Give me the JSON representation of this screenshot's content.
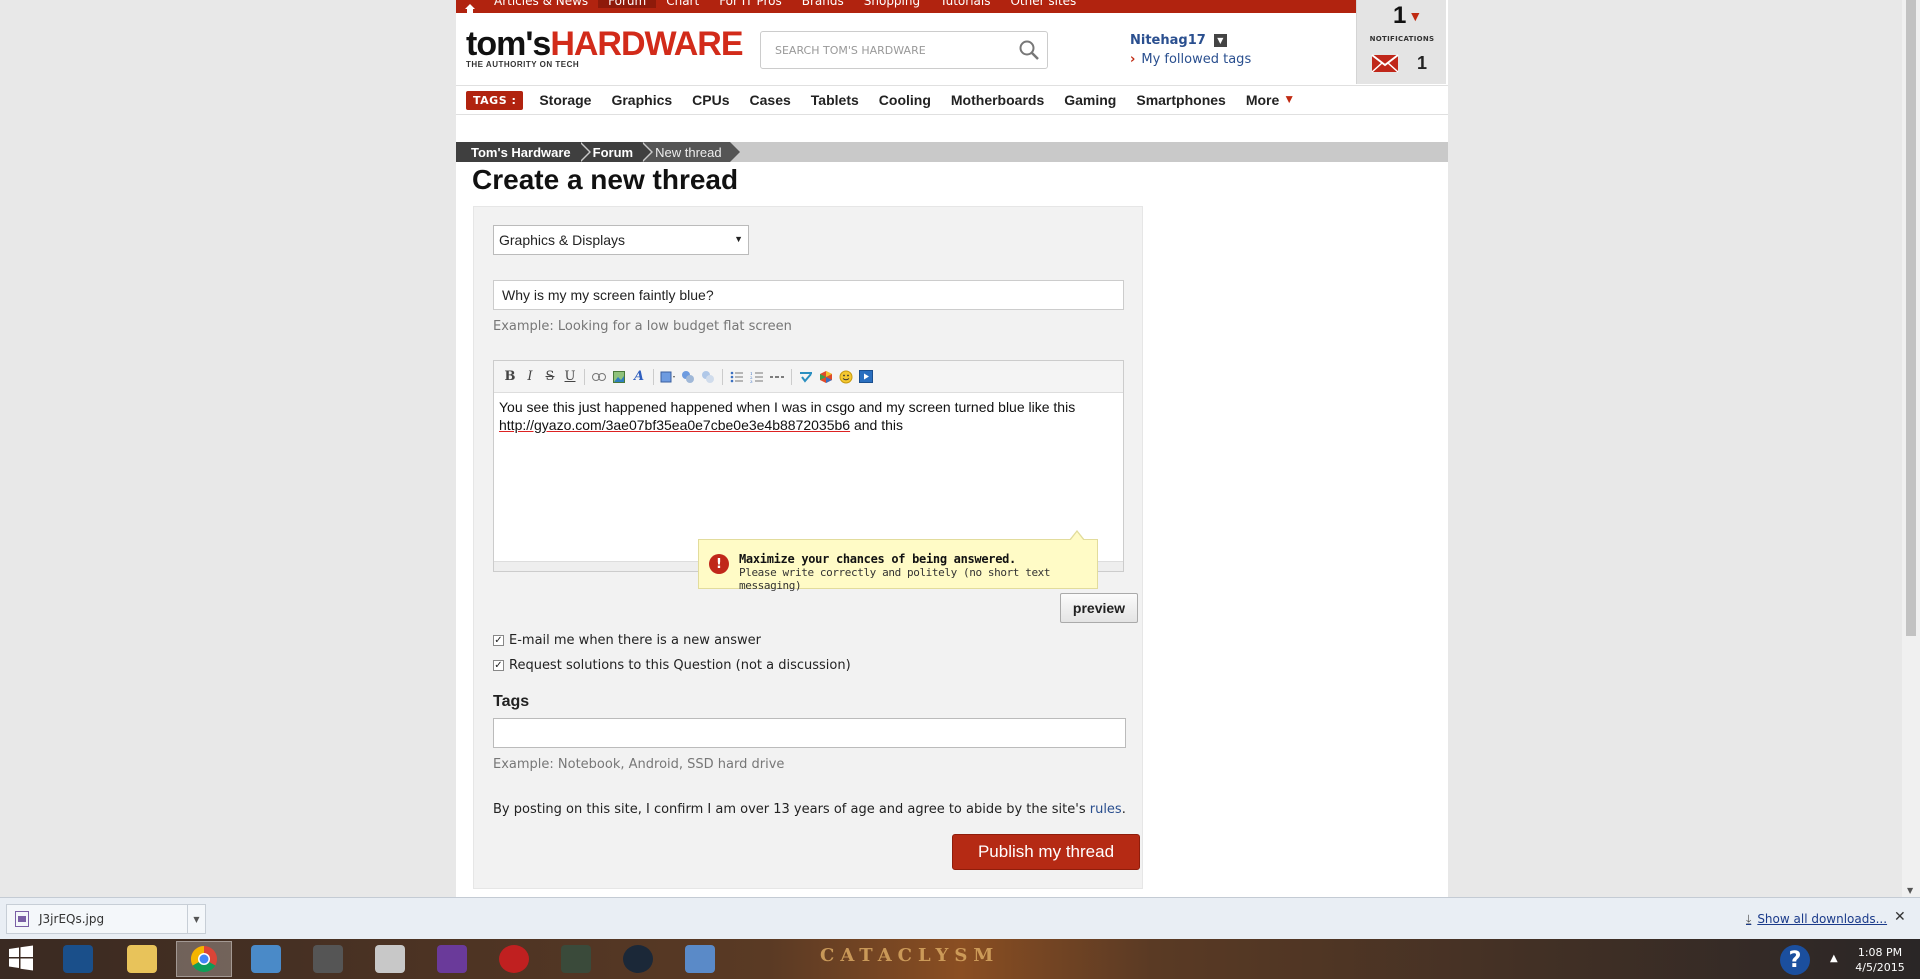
{
  "topnav": {
    "items": [
      "Articles & News",
      "Forum",
      "Chart",
      "For IT Pros",
      "Brands",
      "Shopping",
      "Tutorials",
      "Other sites"
    ]
  },
  "header": {
    "logo_part1": "tom's",
    "logo_part2": "HARDWARE",
    "tagline": "THE AUTHORITY ON TECH",
    "search_placeholder": "SEARCH TOM'S HARDWARE",
    "username": "Nitehag17",
    "followed_tags": "My followed tags"
  },
  "notifications": {
    "count": "1",
    "label": "NOTIFICATIONS",
    "mail_count": "1"
  },
  "tagsbar": {
    "label": "TAGS :",
    "tags": [
      "Storage",
      "Graphics",
      "CPUs",
      "Cases",
      "Tablets",
      "Cooling",
      "Motherboards",
      "Gaming",
      "Smartphones"
    ],
    "more": "More"
  },
  "breadcrumb": [
    "Tom's Hardware",
    "Forum",
    "New thread"
  ],
  "page_title": "Create a new thread",
  "form": {
    "category": "Graphics & Displays",
    "thread_title": "Why is my my screen faintly blue?",
    "title_example": "Example: Looking for a low budget flat screen",
    "body_line1": "You see this just happened happened when I was in csgo and my screen turned blue like this",
    "body_link": "http://gyazo.com/3ae07bf35ea0e7cbe0e3e4b8872035b6",
    "body_after_link": " and this",
    "tip_title": "Maximize your chances of being answered.",
    "tip_text": "Please write correctly and politely (no short text messaging)",
    "preview_label": "preview",
    "checkbox_email": "E-mail me when there is a new answer",
    "checkbox_solutions": "Request solutions to this Question (not a discussion)",
    "tags_label": "Tags",
    "tags_example": "Example: Notebook, Android, SSD hard drive",
    "consent_text": "By posting on this site, I confirm I am over 13 years of age and agree to abide by the site's ",
    "consent_link": "rules",
    "consent_end": ".",
    "publish_label": "Publish my thread"
  },
  "downloads": {
    "file_name": "J3jrEQs.jpg",
    "show_all": "Show all downloads..."
  },
  "taskbar": {
    "wallpaper_text": "CATACLYSM",
    "time": "1:08 PM",
    "date": "4/5/2015"
  }
}
